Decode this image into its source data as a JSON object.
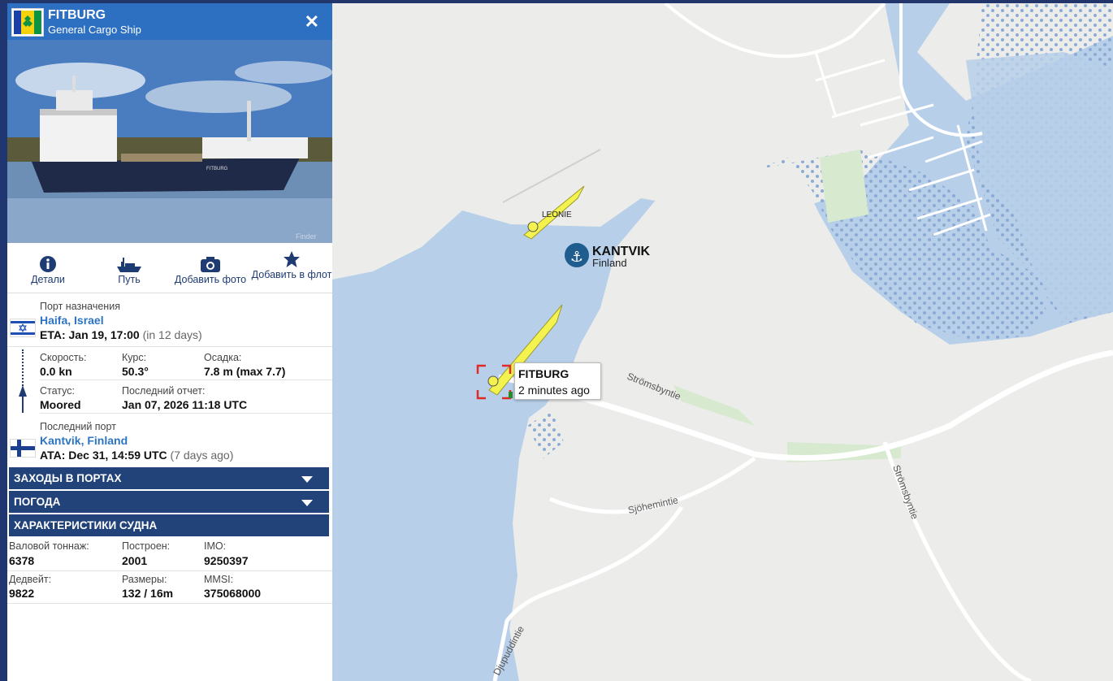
{
  "vessel": {
    "name": "FITBURG",
    "type": "General Cargo Ship",
    "flag_icon": "saint-vincent-grenadines-flag-icon",
    "close_icon": "close-icon"
  },
  "photo": {
    "watermark": "Finder",
    "hull_text": "FITBURG"
  },
  "actions": [
    {
      "label": "Детали",
      "icon": "info-icon"
    },
    {
      "label": "Путь",
      "icon": "ship-track-icon"
    },
    {
      "label": "Добавить фото",
      "icon": "camera-icon"
    },
    {
      "label": "Добавить в флот",
      "icon": "star-icon"
    }
  ],
  "destination": {
    "label": "Порт назначения",
    "port": "Haifa, Israel",
    "eta": "ETA: Jan 19, 17:00",
    "eta_rel": "(in 12 days)",
    "flag_icon": "israel-flag-icon"
  },
  "nav": {
    "speed_label": "Скорость:",
    "speed": "0.0 kn",
    "course_label": "Курс:",
    "course": "50.3°",
    "draught_label": "Осадка:",
    "draught": "7.8 m (max 7.7)",
    "status_label": "Статус:",
    "status": "Moored",
    "report_label": "Последний отчет:",
    "report": "Jan 07, 2026 11:18 UTC"
  },
  "last_port": {
    "label": "Последний порт",
    "port": "Kantvik, Finland",
    "ata": "ATA: Dec 31, 14:59 UTC",
    "ata_rel": "(7 days ago)",
    "flag_icon": "finland-flag-icon"
  },
  "sections": {
    "port_calls": "ЗАХОДЫ В ПОРТАХ",
    "weather": "ПОГОДА",
    "specs": "ХАРАКТЕРИСТИКИ СУДНА"
  },
  "specs": {
    "gt_label": "Валовой тоннаж:",
    "gt": "6378",
    "built_label": "Построен:",
    "built": "2001",
    "imo_label": "IMO:",
    "imo": "9250397",
    "dwt_label": "Дедвейт:",
    "dwt": "9822",
    "dims_label": "Размеры:",
    "dims": "132 / 16m",
    "mmsi_label": "MMSI:",
    "mmsi": "375068000"
  },
  "map": {
    "port_name": "KANTVIK",
    "port_country": "Finland",
    "port_icon": "anchor-icon",
    "other_vessel": "LEONIE",
    "tooltip_name": "FITBURG",
    "tooltip_age": "2 minutes ago",
    "roads": [
      "Strömsbyntie",
      "Sjöhemintie",
      "Strömsbyntie",
      "Djupuddintie"
    ],
    "colors": {
      "water": "#b7cfe9",
      "land": "#ecedea",
      "park": "#d7e9cf",
      "vessel": "#f4f24f"
    }
  }
}
